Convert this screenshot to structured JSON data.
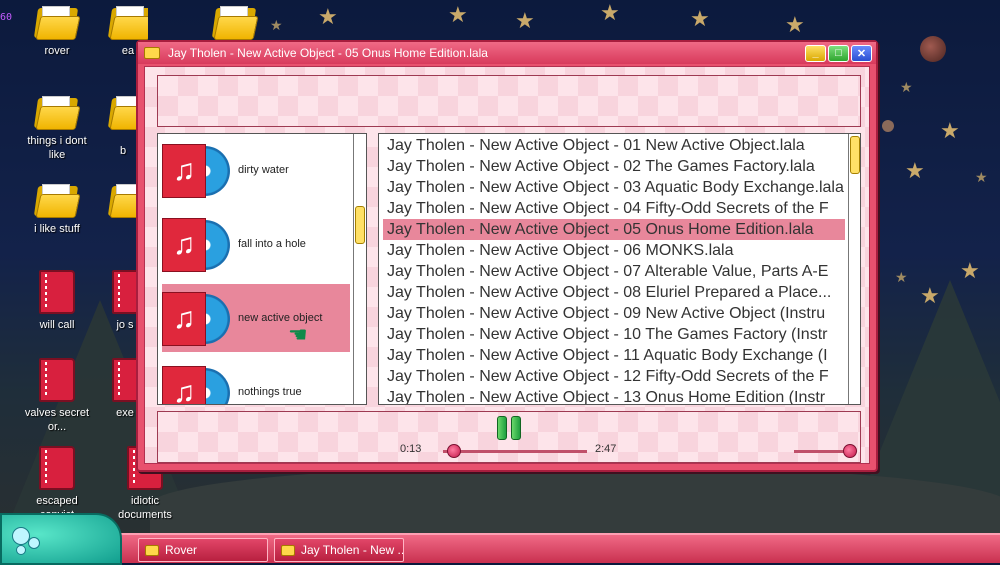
{
  "desktop": {
    "corner_number": "60",
    "icons": [
      {
        "label": "rover",
        "type": "folder"
      },
      {
        "label": "ea",
        "type": "folder"
      },
      {
        "label": "",
        "type": "folder"
      },
      {
        "label": "things i dont like",
        "type": "folder"
      },
      {
        "label": "b",
        "type": "folder"
      },
      {
        "label": "i like stuff",
        "type": "folder"
      },
      {
        "label": "will call",
        "type": "book"
      },
      {
        "label": "jo s",
        "type": "book"
      },
      {
        "label": "valves secret or...",
        "type": "book"
      },
      {
        "label": "exe",
        "type": "book"
      },
      {
        "label": "escaped convict",
        "type": "book"
      },
      {
        "label": "idiotic documents",
        "type": "book"
      }
    ]
  },
  "window": {
    "title": "Jay Tholen - New Active Object - 05 Onus Home Edition.lala",
    "controls": {
      "minimize": "_",
      "maximize": "□",
      "close": "✕"
    }
  },
  "albums": [
    {
      "name": "dirty water",
      "icon": "music-cd-icon",
      "selected": false
    },
    {
      "name": "fall into a hole",
      "icon": "music-cd-icon",
      "selected": false
    },
    {
      "name": "new active object",
      "icon": "music-cd-icon",
      "selected": true
    },
    {
      "name": "nothings true",
      "icon": "music-cd-icon",
      "selected": false
    }
  ],
  "tracks": [
    {
      "title": "Jay Tholen - New Active Object - 01 New Active Object.lala",
      "selected": false
    },
    {
      "title": "Jay Tholen - New Active Object - 02 The Games Factory.lala",
      "selected": false
    },
    {
      "title": "Jay Tholen - New Active Object - 03 Aquatic Body Exchange.lala",
      "selected": false
    },
    {
      "title": "Jay Tholen - New Active Object - 04 Fifty-Odd Secrets of the F",
      "selected": false
    },
    {
      "title": "Jay Tholen - New Active Object - 05 Onus Home Edition.lala",
      "selected": true
    },
    {
      "title": "Jay Tholen - New Active Object - 06 MONKS.lala",
      "selected": false
    },
    {
      "title": "Jay Tholen - New Active Object - 07 Alterable Value, Parts A-E",
      "selected": false
    },
    {
      "title": "Jay Tholen - New Active Object - 08 Eluriel Prepared a Place...",
      "selected": false
    },
    {
      "title": "Jay Tholen - New Active Object - 09 New Active Object (Instru",
      "selected": false
    },
    {
      "title": "Jay Tholen - New Active Object - 10 The Games Factory (Instr",
      "selected": false
    },
    {
      "title": "Jay Tholen - New Active Object - 11 Aquatic Body Exchange (I",
      "selected": false
    },
    {
      "title": "Jay Tholen - New Active Object - 12 Fifty-Odd Secrets of the F",
      "selected": false
    },
    {
      "title": "Jay Tholen - New Active Object - 13 Onus Home Edition (Instr",
      "selected": false
    }
  ],
  "player": {
    "state": "playing",
    "elapsed": "0:13",
    "duration": "2:47",
    "progress_fraction": 0.078,
    "volume_fraction": 1.0
  },
  "taskbar": {
    "buttons": [
      {
        "label": "Rover"
      },
      {
        "label": "Jay Tholen - New ..."
      }
    ]
  },
  "colors": {
    "window_accent": "#e8516e",
    "selection": "#e8879b",
    "taskbar": "#d83a5c"
  }
}
